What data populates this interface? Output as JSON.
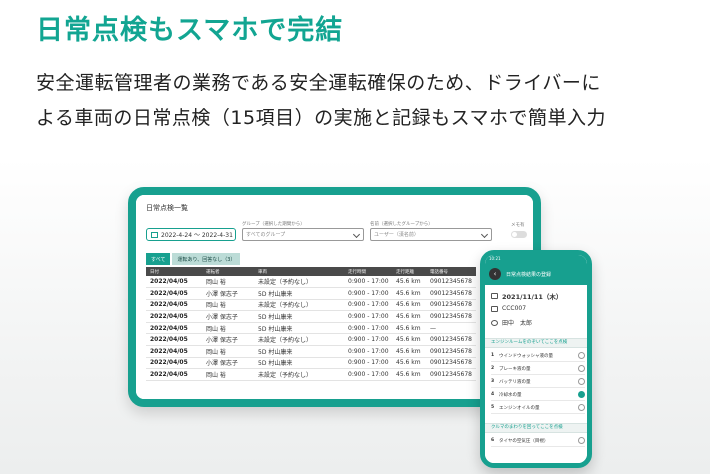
{
  "headline": "日常点検もスマホで完結",
  "description": {
    "line1": "安全運転管理者の業務である安全運転確保のため、ドライバーに",
    "line2": "よる車両の日常点検（15項目）の実施と記録もスマホで簡単入力"
  },
  "tablet": {
    "title": "日常点検一覧",
    "date_range": "2022-4-24 ～ 2022-4-31",
    "group_label": "グループ（選択した期間から）",
    "group_value": "すべてのグループ",
    "user_label": "名前（選択したグループから）",
    "user_value": "ユーザー（漢名前）",
    "memo_label": "メモ有",
    "tabs": [
      "すべて",
      "運転あり、回答なし（3）"
    ],
    "columns": [
      "日付",
      "運転者",
      "車両",
      "走行時間",
      "走行距離",
      "電話番号"
    ],
    "rows": [
      [
        "2022/04/05",
        "岡山 裕",
        "未設定（予約なし）",
        "0:900 - 17:00",
        "45.6 km",
        "09012345678"
      ],
      [
        "2022/04/05",
        "小澤 保志子",
        "5D 村山康来",
        "0:900 - 17:00",
        "45.6 km",
        "09012345678"
      ],
      [
        "2022/04/05",
        "岡山 裕",
        "未設定（予約なし）",
        "0:900 - 17:00",
        "45.6 km",
        "09012345678"
      ],
      [
        "2022/04/05",
        "小澤 保志子",
        "5D 村山康来",
        "0:900 - 17:00",
        "45.6 km",
        "09012345678"
      ],
      [
        "2022/04/05",
        "岡山 裕",
        "5D 村山康来",
        "0:900 - 17:00",
        "45.6 km",
        "—"
      ],
      [
        "2022/04/05",
        "小澤 保志子",
        "未設定（予約なし）",
        "0:900 - 17:00",
        "45.6 km",
        "09012345678"
      ],
      [
        "2022/04/05",
        "岡山 裕",
        "5D 村山康来",
        "0:900 - 17:00",
        "45.6 km",
        "09012345678"
      ],
      [
        "2022/04/05",
        "小澤 保志子",
        "5D 村山康来",
        "0:900 - 17:00",
        "45.6 km",
        "09012345678"
      ],
      [
        "2022/04/05",
        "岡山 裕",
        "未設定（予約なし）",
        "0:900 - 17:00",
        "45.6 km",
        "09012345678"
      ]
    ]
  },
  "phone": {
    "status_time": "10:21",
    "title": "日常点検結果の登録",
    "date": "2021/11/11（木）",
    "vehicle": "CCC007",
    "driver": "田中　太郎",
    "section1": "エンジンルームをのぞいてここを点検",
    "items": [
      {
        "num": "1",
        "label": "ウインドウォッシャ液の量",
        "checked": false
      },
      {
        "num": "2",
        "label": "ブレーキ液の量",
        "checked": false
      },
      {
        "num": "3",
        "label": "バッテリ液の量",
        "checked": false
      },
      {
        "num": "4",
        "label": "冷却水の量",
        "checked": true
      },
      {
        "num": "5",
        "label": "エンジンオイルの量",
        "checked": false
      }
    ],
    "section2": "クルマのまわりを回ってここを点検",
    "items2": [
      {
        "num": "6",
        "label": "タイヤの空気圧（目視）",
        "checked": false
      }
    ]
  },
  "colors": {
    "accent": "#17a08f",
    "headline": "#12a592"
  }
}
